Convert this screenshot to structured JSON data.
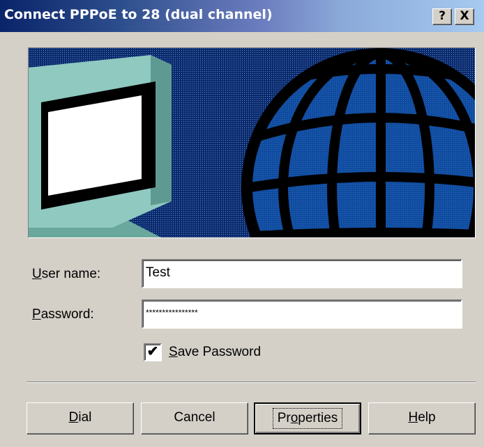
{
  "window": {
    "title": "Connect PPPoE to 28 (dual channel)",
    "help_button": "?",
    "close_button": "X"
  },
  "form": {
    "username_label_mnemonic": "U",
    "username_label_rest": "ser name:",
    "username_value": "Test",
    "password_label_mnemonic": "P",
    "password_label_rest": "assword:",
    "password_value": "****************",
    "save_password_checked": true,
    "save_password_mnemonic": "S",
    "save_password_rest": "ave Password"
  },
  "buttons": {
    "dial_mnemonic": "D",
    "dial_rest": "ial",
    "cancel": "Cancel",
    "properties_pre": "Pr",
    "properties_mnemonic": "o",
    "properties_post": "perties",
    "help_mnemonic": "H",
    "help_rest": "elp"
  },
  "banner": {
    "icon": "computer-globe-illustration"
  },
  "colors": {
    "titlebar_start": "#0a246a",
    "titlebar_end": "#a6caf0",
    "banner_background": "#0b2a6c",
    "globe": "#0f4ca0",
    "dialog": "#d4d0c8"
  }
}
